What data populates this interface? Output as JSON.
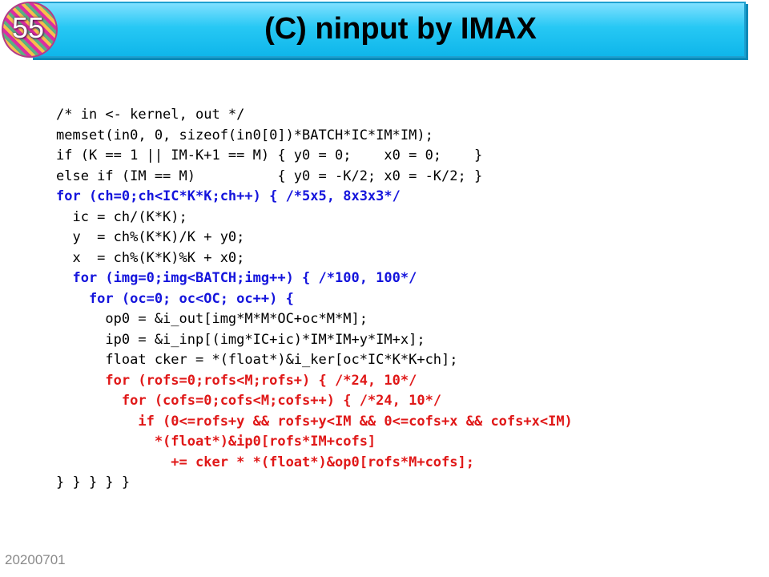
{
  "slide": {
    "number": "55",
    "title": "(C) ninput by IMAX",
    "date": "20200701",
    "colors": {
      "title_bar": "#27c8f4",
      "code_blue": "#1414dc",
      "code_red": "#e01818",
      "badge": "#d64aa8"
    }
  },
  "code": {
    "lines": [
      {
        "text": "/* in <- kernel, out */",
        "color": "black"
      },
      {
        "text": "memset(in0, 0, sizeof(in0[0])*BATCH*IC*IM*IM);",
        "color": "black"
      },
      {
        "text": "if (K == 1 || IM-K+1 == M) { y0 = 0;    x0 = 0;    }",
        "color": "black"
      },
      {
        "text": "else if (IM == M)          { y0 = -K/2; x0 = -K/2; }",
        "color": "black"
      },
      {
        "text": "for (ch=0;ch<IC*K*K;ch++) { /*5x5, 8x3x3*/",
        "color": "blue"
      },
      {
        "text": "  ic = ch/(K*K);",
        "color": "black"
      },
      {
        "text": "  y  = ch%(K*K)/K + y0;",
        "color": "black"
      },
      {
        "text": "  x  = ch%(K*K)%K + x0;",
        "color": "black"
      },
      {
        "text": "  for (img=0;img<BATCH;img++) { /*100, 100*/",
        "color": "blue"
      },
      {
        "text": "    for (oc=0; oc<OC; oc++) {",
        "color": "blue"
      },
      {
        "text": "      op0 = &i_out[img*M*M*OC+oc*M*M];",
        "color": "black"
      },
      {
        "text": "      ip0 = &i_inp[(img*IC+ic)*IM*IM+y*IM+x];",
        "color": "black"
      },
      {
        "text": "      float cker = *(float*)&i_ker[oc*IC*K*K+ch];",
        "color": "black"
      },
      {
        "text": "      for (rofs=0;rofs<M;rofs+) { /*24, 10*/",
        "color": "red"
      },
      {
        "text": "        for (cofs=0;cofs<M;cofs++) { /*24, 10*/",
        "color": "red"
      },
      {
        "text": "          if (0<=rofs+y && rofs+y<IM && 0<=cofs+x && cofs+x<IM)",
        "color": "red"
      },
      {
        "text": "            *(float*)&ip0[rofs*IM+cofs]",
        "color": "red"
      },
      {
        "text": "              += cker * *(float*)&op0[rofs*M+cofs];",
        "color": "red"
      },
      {
        "text": "} } } } }",
        "color": "black"
      }
    ]
  }
}
